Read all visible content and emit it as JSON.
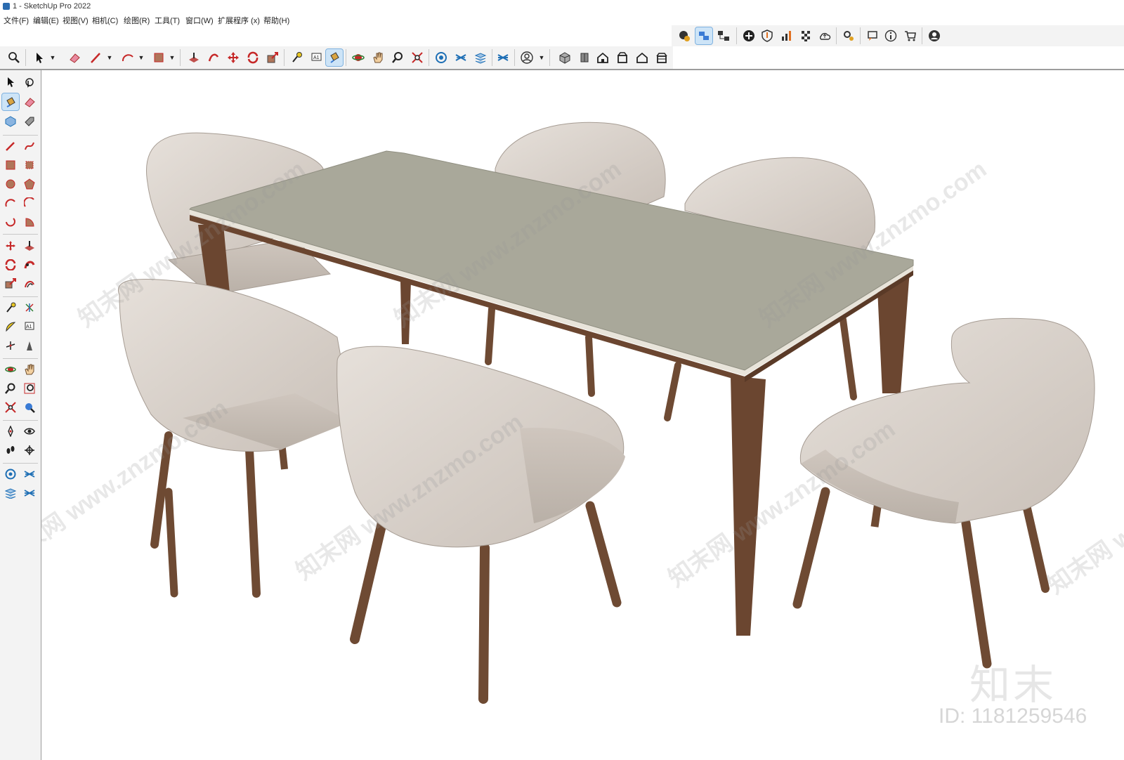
{
  "window": {
    "title": "1 - SketchUp Pro 2022"
  },
  "menu": {
    "items": [
      "文件(F)",
      "编辑(E)",
      "视图(V)",
      "相机(C)",
      "绘图(R)",
      "工具(T)",
      "窗口(W)",
      "扩展程序 (x)",
      "帮助(H)"
    ]
  },
  "watermarks": {
    "site": "知末网 www.znzmo.com",
    "brand": "知末",
    "id": "ID: 1181259546"
  },
  "colors": {
    "toolbar_bg": "#f3f3f3",
    "active_tool": "#cde4f7",
    "table_top": "#a9a89a",
    "table_wood": "#6b4630",
    "chair_fabric": "#d8d0c8",
    "chair_leg": "#6e4a33"
  }
}
